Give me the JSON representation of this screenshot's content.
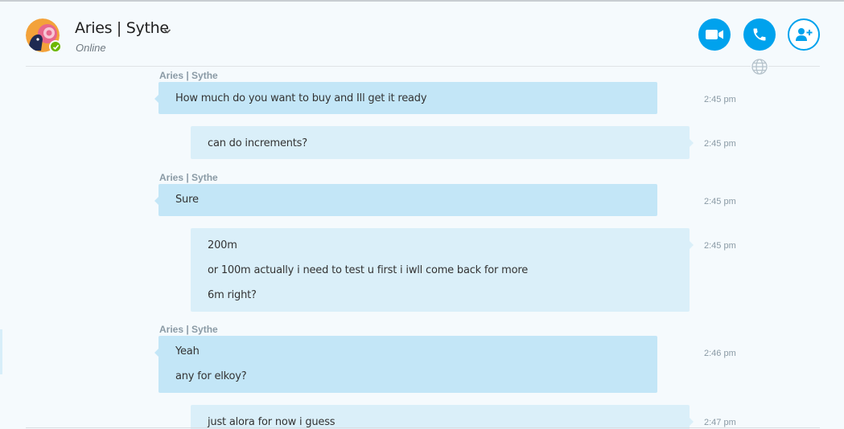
{
  "header": {
    "contact_name": "Aries | Sythe",
    "status": "Online",
    "video_call_icon": "video-camera-icon",
    "audio_call_icon": "phone-icon",
    "add_people_icon": "add-person-icon",
    "globe_icon": "globe-icon"
  },
  "colors": {
    "accent": "#00a2ed",
    "incoming_bubble": "#c3e6f7",
    "outgoing_bubble": "#daeff9",
    "presence_online": "#6bb700"
  },
  "messages": [
    {
      "sender": "Aries | Sythe",
      "direction": "incoming",
      "lines": [
        "How much do you want to buy and Ill get it ready"
      ],
      "time": "2:45 pm"
    },
    {
      "sender": "",
      "direction": "outgoing",
      "lines": [
        "can do increments?"
      ],
      "time": "2:45 pm"
    },
    {
      "sender": "Aries | Sythe",
      "direction": "incoming",
      "lines": [
        "Sure"
      ],
      "time": "2:45 pm"
    },
    {
      "sender": "",
      "direction": "outgoing",
      "lines": [
        "200m",
        "or 100m actually i need to test u first i iwll come back for more",
        "6m right?"
      ],
      "time": "2:45 pm"
    },
    {
      "sender": "Aries | Sythe",
      "direction": "incoming",
      "lines": [
        "Yeah",
        "any for elkoy?"
      ],
      "time": "2:46 pm"
    },
    {
      "sender": "",
      "direction": "outgoing",
      "lines": [
        "just alora for now i guess"
      ],
      "time": "2:47 pm"
    }
  ]
}
